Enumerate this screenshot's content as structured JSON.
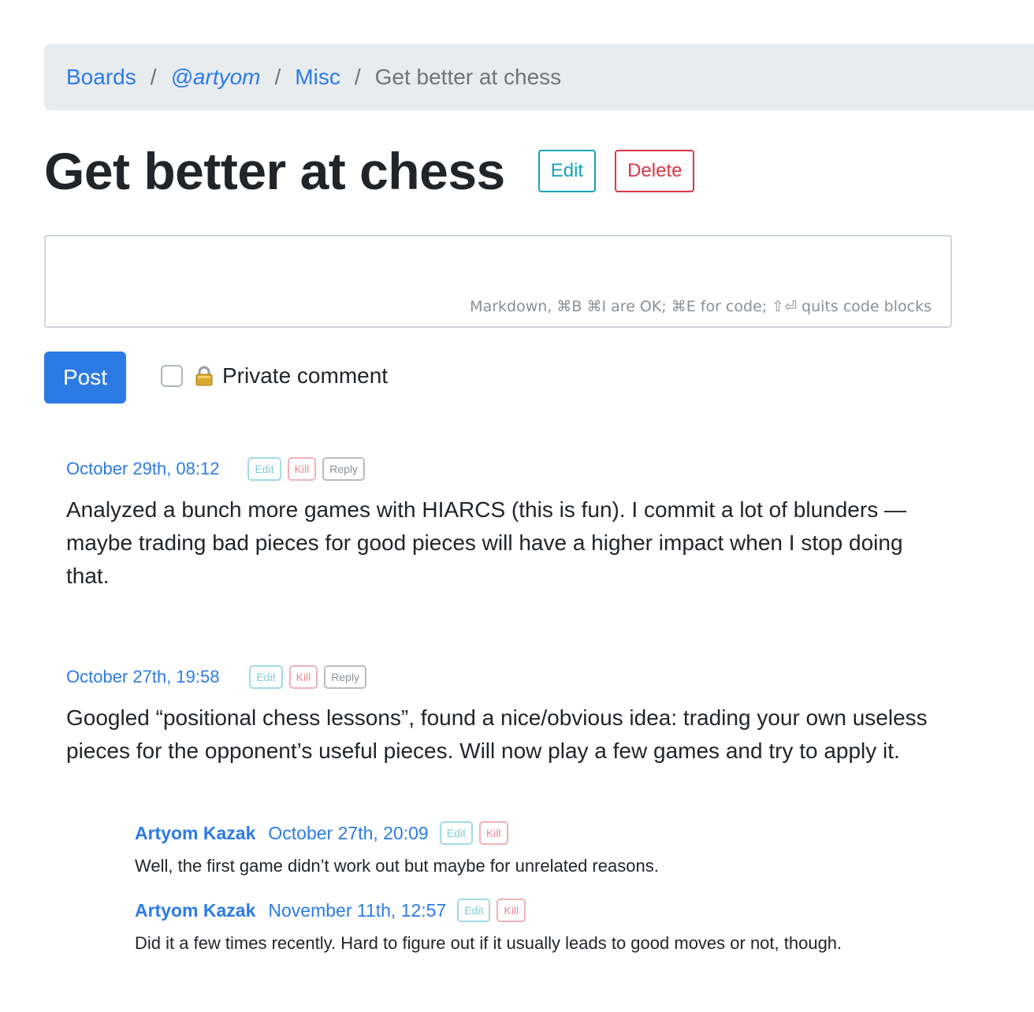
{
  "breadcrumb": {
    "boards": "Boards",
    "user": "@artyom",
    "board": "Misc",
    "current": "Get better at chess",
    "separator": "/"
  },
  "page": {
    "title": "Get better at chess",
    "edit_label": "Edit",
    "delete_label": "Delete"
  },
  "composer": {
    "hint": "Markdown, ⌘B ⌘I are OK; ⌘E for code; ⇧⏎ quits code blocks",
    "post_label": "Post",
    "private_label": "Private comment",
    "private_checked": false
  },
  "entries": [
    {
      "date": "October 29th, 08:12",
      "edit": "Edit",
      "kill": "Kill",
      "reply": "Reply",
      "text": "Analyzed a bunch more games with HIARCS (this is fun). I commit a lot of blunders — maybe trading bad pieces for good pieces will have a higher impact when I stop doing that."
    },
    {
      "date": "October 27th, 19:58",
      "edit": "Edit",
      "kill": "Kill",
      "reply": "Reply",
      "text": "Googled “positional chess lessons”, found a nice/obvious idea: trading your own useless pieces for the opponent’s useful pieces. Will now play a few games and try to apply it.",
      "replies": [
        {
          "author": "Artyom Kazak",
          "date": "October 27th, 20:09",
          "edit": "Edit",
          "kill": "Kill",
          "text": "Well, the first game didn’t work out but maybe for unrelated reasons."
        },
        {
          "author": "Artyom Kazak",
          "date": "November 11th, 12:57",
          "edit": "Edit",
          "kill": "Kill",
          "text": "Did it a few times recently. Hard to figure out if it usually leads to good moves or not, though."
        }
      ]
    }
  ],
  "colors": {
    "link": "#2c7be5",
    "edit": "#17a2b8",
    "delete": "#dc3545",
    "breadcrumb_bg": "#e9ecef"
  }
}
